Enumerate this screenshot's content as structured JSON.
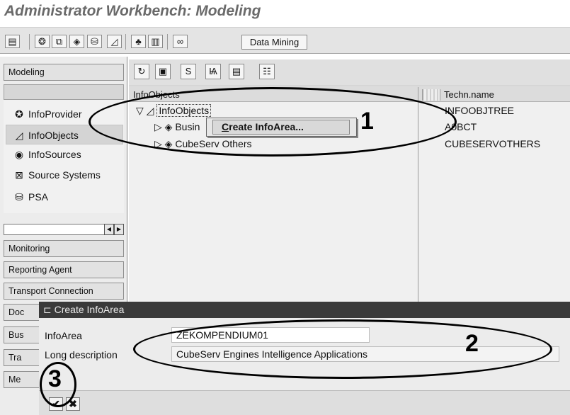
{
  "window": {
    "title": "Administrator Workbench: Modeling"
  },
  "toolbar": {
    "icons": [
      "table-icon",
      "cube-group-icon",
      "cubes-icon",
      "cube-icon",
      "cylinder-icon",
      "infoobject-icon",
      "hierarchy-icon",
      "layout-icon",
      "link-icon"
    ],
    "data_mining_label": "Data Mining"
  },
  "left_panel": {
    "header": "Modeling",
    "items": [
      {
        "label": "InfoProvider",
        "icon": "infoprovider-icon"
      },
      {
        "label": "InfoObjects",
        "icon": "infoobject-icon"
      },
      {
        "label": "InfoSources",
        "icon": "infosource-icon"
      },
      {
        "label": "Source Systems",
        "icon": "source-system-icon"
      },
      {
        "label": "PSA",
        "icon": "psa-icon"
      }
    ],
    "sections": [
      "Monitoring",
      "Reporting Agent",
      "Transport Connection",
      "Doc",
      "Bus",
      "Tra",
      "Me"
    ]
  },
  "tree": {
    "columns": {
      "name": "InfoObjects",
      "techn": "Techn.name"
    },
    "rows": [
      {
        "label": "InfoObjects",
        "techn": "INFOOBJTREE"
      },
      {
        "label": "Busin",
        "techn": "A0BCT"
      },
      {
        "label": "CubeServ Others",
        "techn": "CUBESERVOTHERS"
      }
    ]
  },
  "context_menu": {
    "item_prefix": "C",
    "item_rest": "reate InfoArea..."
  },
  "dialog": {
    "title": "Create InfoArea",
    "infoarea_label": "InfoArea",
    "infoarea_value": "ZEKOMPENDIUM01",
    "desc_label": "Long description",
    "desc_value": "CubeServ Engines Intelligence Applications"
  },
  "annotations": {
    "step1": "1",
    "step2": "2",
    "step3": "3"
  }
}
